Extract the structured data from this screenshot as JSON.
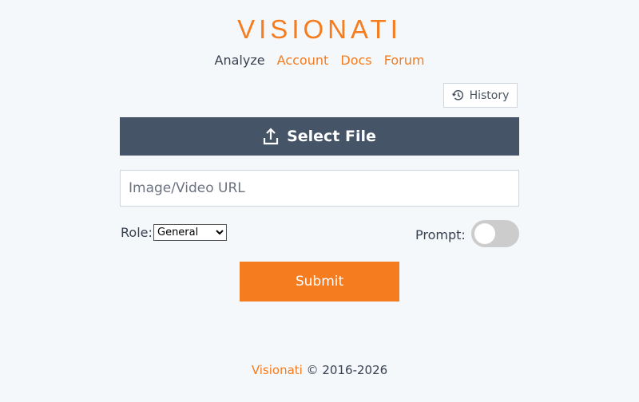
{
  "brand": "VISIONATI",
  "nav": {
    "items": [
      {
        "label": "Analyze",
        "active": true
      },
      {
        "label": "Account",
        "active": false
      },
      {
        "label": "Docs",
        "active": false
      },
      {
        "label": "Forum",
        "active": false
      }
    ]
  },
  "history_button": {
    "label": "History",
    "icon": "history-icon"
  },
  "select_file_button": {
    "label": "Select File",
    "icon": "upload-icon"
  },
  "url_input": {
    "placeholder": "Image/Video URL",
    "value": ""
  },
  "role": {
    "label": "Role:",
    "selected": "General"
  },
  "prompt": {
    "label": "Prompt:",
    "enabled": false
  },
  "submit_button": {
    "label": "Submit"
  },
  "footer": {
    "brand": "Visionati",
    "copyright": "© 2016-2026"
  },
  "colors": {
    "accent": "#f57c1f",
    "primary_dark": "#465468",
    "background": "#f5f8fa",
    "toggle_off": "#cccccc"
  }
}
